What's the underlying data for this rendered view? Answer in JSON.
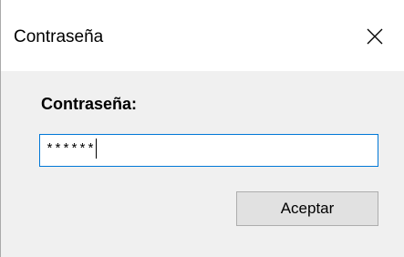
{
  "window": {
    "title": "Contraseña",
    "close_icon": "close-icon"
  },
  "form": {
    "label": "Contraseña:",
    "password_value": "******",
    "ok_label": "Aceptar"
  },
  "colors": {
    "titlebar_bg": "#ffffff",
    "body_bg": "#f0f0f0",
    "input_border_focus": "#0078d7",
    "button_bg": "#e1e1e1",
    "button_border": "#adadad"
  }
}
